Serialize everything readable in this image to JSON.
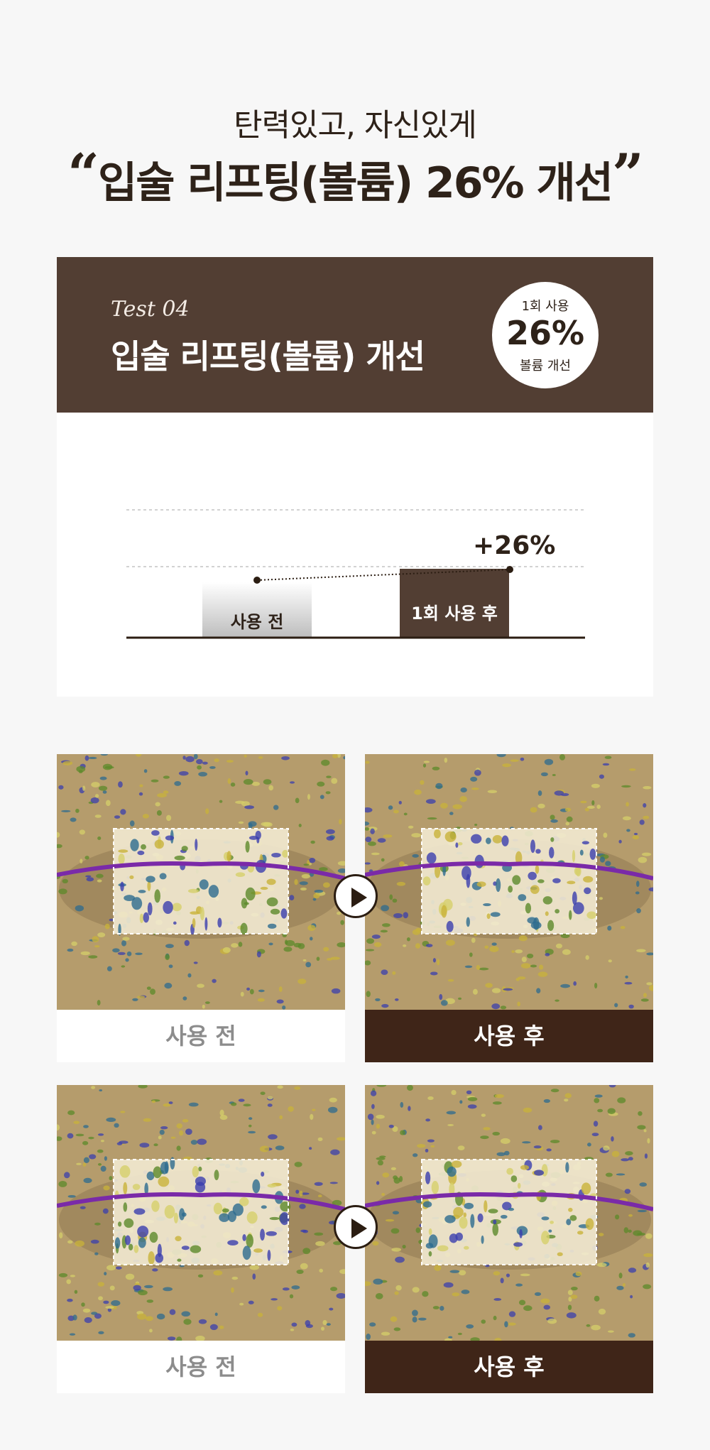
{
  "headline": {
    "sub": "탄력있고, 자신있게",
    "open_quote": "“",
    "main": "입술 리프팅(볼륨) 26% 개선",
    "close_quote": "”"
  },
  "card": {
    "test_label": "Test 04",
    "title": "입술 리프팅(볼륨) 개선",
    "badge": {
      "top": "1회 사용",
      "value": "26%",
      "bottom": "볼륨 개선"
    }
  },
  "chart_data": {
    "type": "bar",
    "categories": [
      "사용 전",
      "1회 사용 후"
    ],
    "values": [
      100,
      126
    ],
    "delta_label": "+26%",
    "colors": {
      "before": "#bdbdbd",
      "after": "#523e33",
      "axis": "#2b1d12",
      "grid": "#c4c4c4"
    }
  },
  "comparisons": [
    {
      "before_label": "사용 전",
      "after_label": "사용 후"
    },
    {
      "before_label": "사용 전",
      "after_label": "사용 후"
    }
  ]
}
